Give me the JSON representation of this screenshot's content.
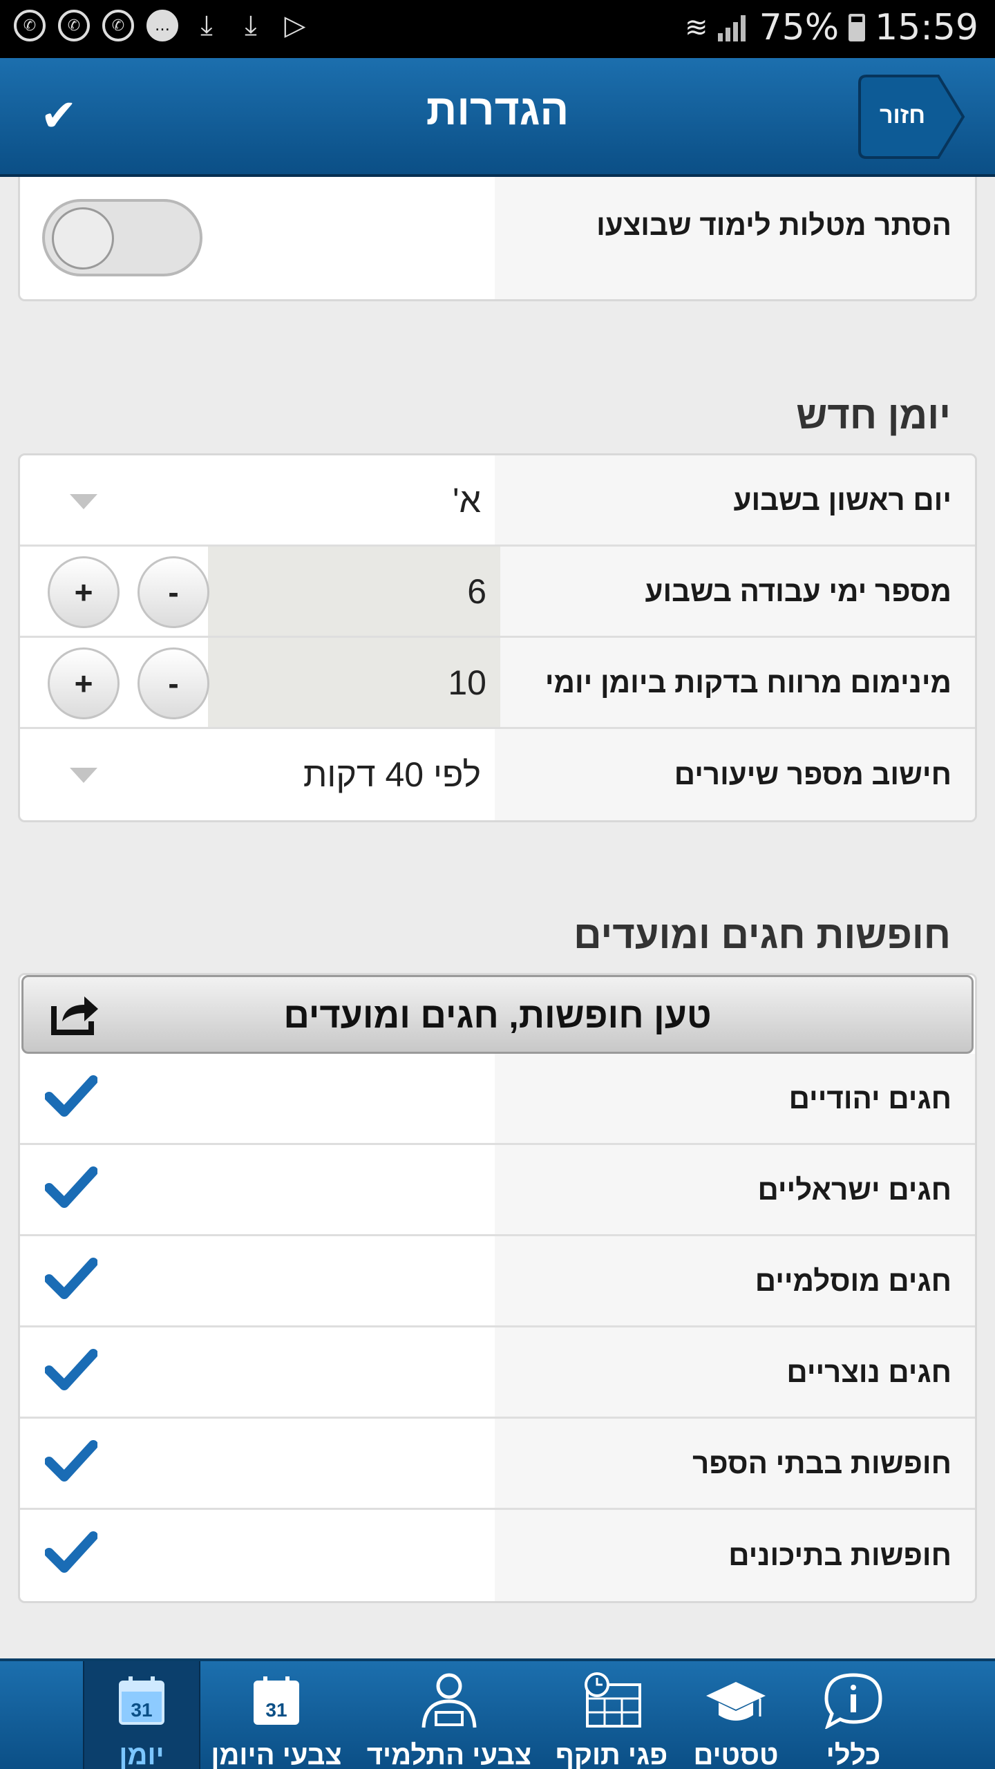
{
  "status_bar": {
    "battery": "75%",
    "time": "15:59"
  },
  "header": {
    "title": "הגדרות",
    "back_label": "חזור"
  },
  "top_card": {
    "hide_completed_label": "הסתר מטלות לימוד שבוצעו"
  },
  "new_diary": {
    "section_title": "יומן חדש",
    "first_day_label": "יום ראשון בשבוע",
    "first_day_value": "א'",
    "work_days_label": "מספר ימי עבודה בשבוע",
    "work_days_value": "6",
    "min_gap_label": "מינימום מרווח בדקות ביומן יומי",
    "min_gap_value": "10",
    "lessons_calc_label": "חישוב מספר שיעורים",
    "lessons_calc_value": "לפי 40 דקות",
    "minus": "-",
    "plus": "+"
  },
  "holidays": {
    "section_title": "חופשות חגים ומועדים",
    "load_button": "טען חופשות, חגים ומועדים",
    "items": [
      {
        "label": "חגים יהודיים"
      },
      {
        "label": "חגים ישראליים"
      },
      {
        "label": "חגים מוסלמיים"
      },
      {
        "label": "חגים נוצריים"
      },
      {
        "label": "חופשות בבתי הספר"
      },
      {
        "label": "חופשות בתיכונים"
      }
    ]
  },
  "bottom_nav": {
    "diary": "יומן",
    "diary_colors": "צבעי היומן",
    "student_colors": "צבעי התלמיד",
    "validity": "פגי תוקף",
    "tests": "טסטים",
    "general": "כללי",
    "calendar_day": "31"
  },
  "colors": {
    "primary": "#1565a6",
    "check": "#1a6cb5"
  }
}
